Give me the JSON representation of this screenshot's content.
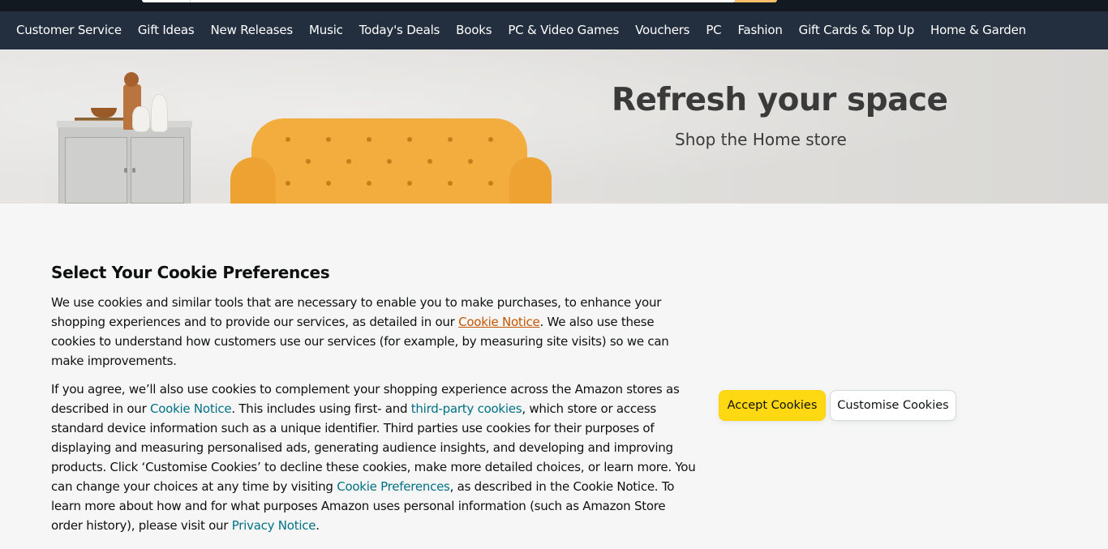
{
  "nav": {
    "items": [
      "Customer Service",
      "Gift Ideas",
      "New Releases",
      "Music",
      "Today's Deals",
      "Books",
      "PC & Video Games",
      "Vouchers",
      "PC",
      "Fashion",
      "Gift Cards & Top Up",
      "Home & Garden"
    ]
  },
  "banner": {
    "title": "Refresh your space",
    "subtitle": "Shop the Home store"
  },
  "cookies": {
    "title": "Select Your Cookie Preferences",
    "p1_a": "We use cookies and similar tools that are necessary to enable you to make purchases, to enhance your shopping experiences and to provide our services, as detailed in our ",
    "p1_link": "Cookie Notice",
    "p1_b": ". We also use these cookies to understand how customers use our services (for example, by measuring site visits) so we can make improvements.",
    "p2_a": "If you agree, we’ll also use cookies to complement your shopping experience across the Amazon stores as described in our ",
    "p2_link1": "Cookie Notice",
    "p2_b": ". This includes using first- and ",
    "p2_link2": "third-party cookies",
    "p2_c": ", which store or access standard device information such as a unique identifier. Third parties use cookies for their purposes of displaying and measuring personalised ads, generating audience insights, and developing and improving products. Click ‘Customise Cookies’ to decline these cookies, make more detailed choices, or learn more. You can change your choices at any time by visiting ",
    "p2_link3": "Cookie Preferences",
    "p2_d": ", as described in the Cookie Notice. To learn more about how and for what purposes Amazon uses personal information (such as Amazon Store order history), please visit our ",
    "p2_link4": "Privacy Notice",
    "p2_e": ".",
    "accept_label": "Accept Cookies",
    "customise_label": "Customise Cookies"
  },
  "colors": {
    "header_bg": "#131921",
    "nav_bg": "#232f3e",
    "accept_button": "#ffd814",
    "link": "#007185",
    "link_visited": "#c45500"
  }
}
